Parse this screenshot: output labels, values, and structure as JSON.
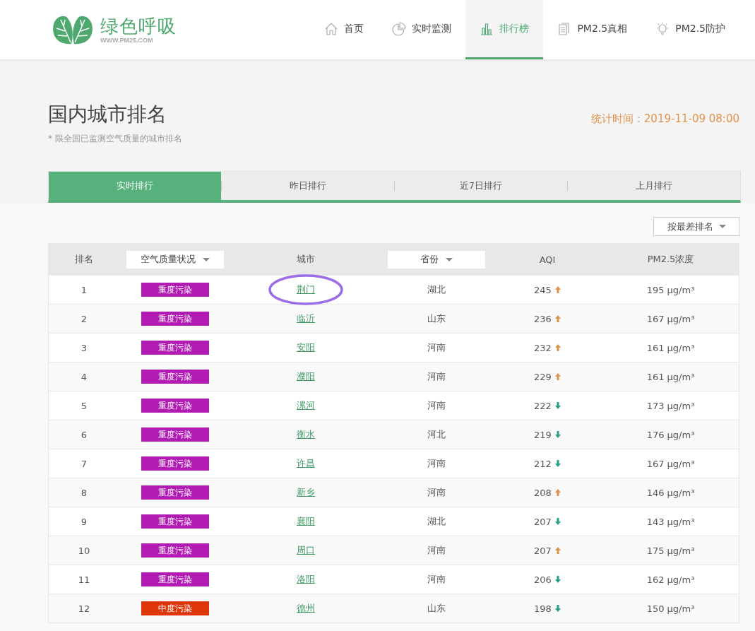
{
  "logo": {
    "title": "绿色呼吸",
    "subtitle": "WWW.PM25.COM"
  },
  "nav": [
    {
      "label": "首页",
      "kind": "home",
      "selected": false
    },
    {
      "label": "实时监测",
      "kind": "pie",
      "selected": false
    },
    {
      "label": "排行榜",
      "kind": "bars",
      "selected": true
    },
    {
      "label": "PM2.5真相",
      "kind": "doc",
      "selected": false
    },
    {
      "label": "PM2.5防护",
      "kind": "bulb",
      "selected": false
    }
  ],
  "page": {
    "title": "国内城市排名",
    "note": "* 限全国已监测空气质量的城市排名",
    "stat_time": "统计时间：2019-11-09 08:00"
  },
  "tabs": [
    {
      "label": "实时排行",
      "selected": true
    },
    {
      "label": "昨日排行",
      "selected": false
    },
    {
      "label": "近7日排行",
      "selected": false
    },
    {
      "label": "上月排行",
      "selected": false
    }
  ],
  "sort_dropdown": "按最差排名",
  "table": {
    "columns": [
      {
        "label": "排名",
        "filter": false
      },
      {
        "label": "空气质量状况",
        "filter": true
      },
      {
        "label": "城市",
        "filter": false
      },
      {
        "label": "省份",
        "filter": true
      },
      {
        "label": "AQI",
        "filter": false
      },
      {
        "label": "PM2.5浓度",
        "filter": false
      }
    ],
    "rows": [
      {
        "rank": "1",
        "quality": "重度污染",
        "color": "#b11ab3",
        "city": "荆门",
        "circled": true,
        "province": "湖北",
        "aqi": "245",
        "rising": true,
        "pm25": "195 μg/m³"
      },
      {
        "rank": "2",
        "quality": "重度污染",
        "color": "#b11ab3",
        "city": "临沂",
        "circled": false,
        "province": "山东",
        "aqi": "236",
        "rising": true,
        "pm25": "167 μg/m³"
      },
      {
        "rank": "3",
        "quality": "重度污染",
        "color": "#b11ab3",
        "city": "安阳",
        "circled": false,
        "province": "河南",
        "aqi": "232",
        "rising": true,
        "pm25": "161 μg/m³"
      },
      {
        "rank": "4",
        "quality": "重度污染",
        "color": "#b11ab3",
        "city": "濮阳",
        "circled": false,
        "province": "河南",
        "aqi": "229",
        "rising": true,
        "pm25": "161 μg/m³"
      },
      {
        "rank": "5",
        "quality": "重度污染",
        "color": "#b11ab3",
        "city": "漯河",
        "circled": false,
        "province": "河南",
        "aqi": "222",
        "rising": false,
        "pm25": "173 μg/m³"
      },
      {
        "rank": "6",
        "quality": "重度污染",
        "color": "#b11ab3",
        "city": "衡水",
        "circled": false,
        "province": "河北",
        "aqi": "219",
        "rising": false,
        "pm25": "176 μg/m³"
      },
      {
        "rank": "7",
        "quality": "重度污染",
        "color": "#b11ab3",
        "city": "许昌",
        "circled": false,
        "province": "河南",
        "aqi": "212",
        "rising": false,
        "pm25": "167 μg/m³"
      },
      {
        "rank": "8",
        "quality": "重度污染",
        "color": "#b11ab3",
        "city": "新乡",
        "circled": false,
        "province": "河南",
        "aqi": "208",
        "rising": true,
        "pm25": "146 μg/m³"
      },
      {
        "rank": "9",
        "quality": "重度污染",
        "color": "#b11ab3",
        "city": "襄阳",
        "circled": false,
        "province": "湖北",
        "aqi": "207",
        "rising": false,
        "pm25": "143 μg/m³"
      },
      {
        "rank": "10",
        "quality": "重度污染",
        "color": "#b11ab3",
        "city": "周口",
        "circled": false,
        "province": "河南",
        "aqi": "207",
        "rising": true,
        "pm25": "175 μg/m³"
      },
      {
        "rank": "11",
        "quality": "重度污染",
        "color": "#b11ab3",
        "city": "洛阳",
        "circled": false,
        "province": "河南",
        "aqi": "206",
        "rising": false,
        "pm25": "162 μg/m³"
      },
      {
        "rank": "12",
        "quality": "中度污染",
        "color": "#de350b",
        "city": "德州",
        "circled": false,
        "province": "山东",
        "aqi": "198",
        "rising": false,
        "pm25": "150 μg/m³"
      }
    ]
  }
}
